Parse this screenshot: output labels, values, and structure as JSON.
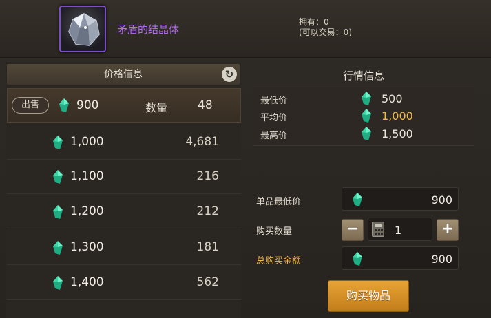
{
  "item": {
    "name": "矛盾的结晶体",
    "owned_line": "拥有：0",
    "tradable_line": "(可以交易：0)"
  },
  "price_panel": {
    "title": "价格信息",
    "sell_row": {
      "tag": "出售",
      "price": "900",
      "qty_label": "数量",
      "qty_value": "48"
    },
    "listings": [
      {
        "price": "1,000",
        "count": "4,681"
      },
      {
        "price": "1,100",
        "count": "216"
      },
      {
        "price": "1,200",
        "count": "212"
      },
      {
        "price": "1,300",
        "count": "181"
      },
      {
        "price": "1,400",
        "count": "562"
      }
    ]
  },
  "market": {
    "title": "行情信息",
    "rows": [
      {
        "label": "最低价",
        "value": "500"
      },
      {
        "label": "平均价",
        "value": "1,000"
      },
      {
        "label": "最高价",
        "value": "1,500"
      }
    ]
  },
  "buy_form": {
    "unit_price_label": "单品最低价",
    "unit_price_value": "900",
    "qty_label": "购买数量",
    "qty_value": "1",
    "minus": "−",
    "plus": "+",
    "total_label": "总购买金额",
    "total_value": "900",
    "buy_button": "购买物品"
  },
  "colors": {
    "gem": "#2fd0a0",
    "accent_gold": "#f0b845",
    "item_name_purple": "#b26cf0",
    "buy_button": "#e0992e"
  },
  "icons": [
    "crystal-item-icon",
    "refresh-icon",
    "gem-currency-icon",
    "calculator-icon"
  ]
}
